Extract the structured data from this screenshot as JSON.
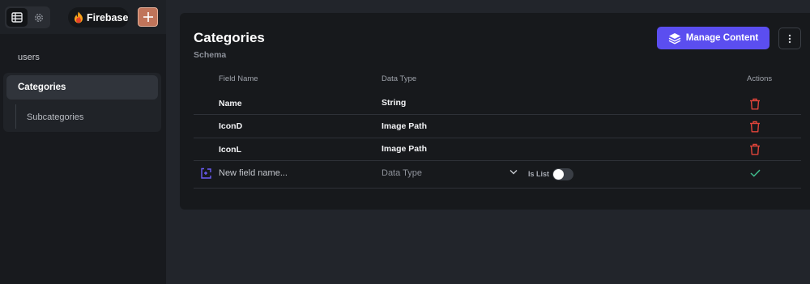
{
  "sidebar": {
    "top": {
      "mode_icons": [
        "table-icon",
        "gear-icon"
      ],
      "project_label": "Firebase",
      "add_icon": "plus-icon"
    },
    "items": [
      {
        "label": "users"
      },
      {
        "label": "Categories",
        "active": true
      },
      {
        "label": "Subcategories"
      }
    ]
  },
  "main": {
    "title": "Categories",
    "subtitle": "Schema",
    "manage_button": "Manage Content",
    "columns": {
      "field_name": "Field Name",
      "data_type": "Data Type",
      "actions": "Actions"
    },
    "rows": [
      {
        "name": "Name",
        "type": "String"
      },
      {
        "name": "IconD",
        "type": "Image Path"
      },
      {
        "name": "IconL",
        "type": "Image Path"
      }
    ],
    "new_field": {
      "placeholder": "New field name...",
      "data_type_placeholder": "Data Type",
      "is_list_label": "Is List",
      "is_list": false
    }
  },
  "colors": {
    "accent": "#5b4ef0",
    "delete": "#e0443a",
    "confirm": "#3fb98a",
    "add_button": "#c0745a"
  }
}
